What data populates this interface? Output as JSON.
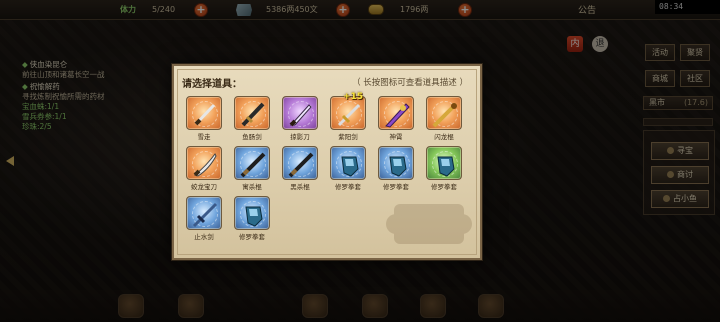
{
  "topbar": {
    "stamina_label": "体力",
    "stamina_value": "5/240",
    "money_value": "5386两450文",
    "gold_value": "1796两",
    "notice_label": "公告",
    "clock": "08:34"
  },
  "quests": [
    {
      "title": "侠血染昆仑",
      "desc": "前往山顶和诸葛长空一战",
      "progress": ""
    },
    {
      "title": "祝愉解药",
      "desc": "寻找炼制祝愉所需的药材",
      "progress": "宝血蛛:1/1\n雪兵券参:1/1\n珍珠:2/5"
    }
  ],
  "right_menu": {
    "row1": [
      "活动",
      "聚贤"
    ],
    "row2": [
      "商城",
      "社区"
    ],
    "market_label": "黑市",
    "market_value": "(17.6)",
    "side_buttons": [
      "寻宝",
      "商讨",
      "占小鱼"
    ]
  },
  "topright_icons": {
    "red_label": "内",
    "close_label": "退"
  },
  "dialog": {
    "title": "请选择道具：",
    "hint": "（ 长按图标可查看道具描述 ）",
    "items": [
      {
        "name": "雪走",
        "rarity": "orange",
        "icon": "dagger-icon",
        "badge": ""
      },
      {
        "name": "鱼肠剑",
        "rarity": "orange",
        "icon": "short-sword-icon",
        "badge": ""
      },
      {
        "name": "掠影刀",
        "rarity": "purple",
        "icon": "blade-icon",
        "badge": ""
      },
      {
        "name": "紫阳剑",
        "rarity": "orange",
        "icon": "sword-icon",
        "badge": "+15"
      },
      {
        "name": "神霄",
        "rarity": "orange",
        "icon": "purple-sword-icon",
        "badge": ""
      },
      {
        "name": "闪龙棍",
        "rarity": "orange",
        "icon": "golden-staff-icon",
        "badge": ""
      },
      {
        "name": "蛟龙宝刀",
        "rarity": "orange",
        "icon": "saber-icon",
        "badge": ""
      },
      {
        "name": "寓杀棍",
        "rarity": "blue",
        "icon": "dark-staff-icon",
        "badge": ""
      },
      {
        "name": "黑杀棍",
        "rarity": "blue",
        "icon": "dark-staff-icon",
        "badge": ""
      },
      {
        "name": "修罗拳套",
        "rarity": "blue",
        "icon": "gauntlet-icon",
        "badge": ""
      },
      {
        "name": "修罗拳套",
        "rarity": "blue",
        "icon": "gauntlet-icon",
        "badge": ""
      },
      {
        "name": "修罗拳套",
        "rarity": "green",
        "icon": "gauntlet-icon",
        "badge": ""
      },
      {
        "name": "止水剑",
        "rarity": "blue",
        "icon": "blue-sword-icon",
        "badge": ""
      },
      {
        "name": "修罗拳套",
        "rarity": "blue",
        "icon": "gauntlet-icon",
        "badge": ""
      }
    ]
  },
  "colors": {
    "accent_green": "#8fd06c",
    "parchment": "#dccdab",
    "badge_yellow": "#f6e23a"
  }
}
